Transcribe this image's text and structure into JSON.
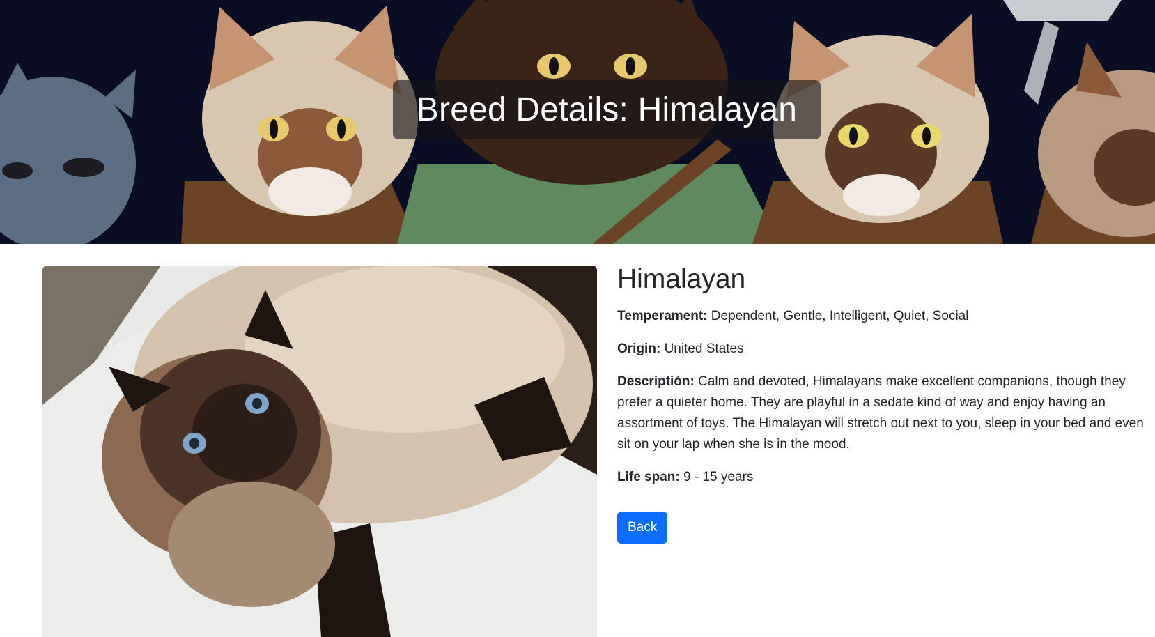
{
  "hero": {
    "title": "Breed Details: Himalayan",
    "image": "cartoon-cats-gang-banner"
  },
  "breed": {
    "photo": "himalayan-cat-photo",
    "name": "Himalayan",
    "temperament_label": "Temperament:",
    "temperament": "Dependent, Gentle, Intelligent, Quiet, Social",
    "origin_label": "Origin:",
    "origin": "United States",
    "description_label": "Descriptión:",
    "description": "Calm and devoted, Himalayans make excellent companions, though they prefer a quieter home. They are playful in a sedate kind of way and enjoy having an assortment of toys. The Himalayan will stretch out next to you, sleep in your bed and even sit on your lap when she is in the mood.",
    "life_span_label": "Life span:",
    "life_span": "9 - 15 years"
  },
  "actions": {
    "back_label": "Back"
  },
  "colors": {
    "primary": "#0d6efd",
    "text": "#212529",
    "hero_bg": "#0b0d24"
  }
}
